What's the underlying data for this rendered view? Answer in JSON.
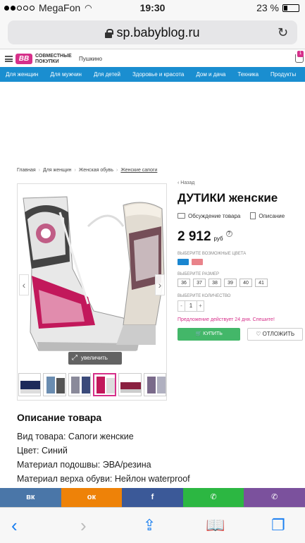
{
  "status_bar": {
    "carrier": "MegaFon",
    "time": "19:30",
    "battery": "23 %",
    "battery_level": 0.23
  },
  "browser": {
    "url": "sp.babyblog.ru"
  },
  "site": {
    "logo_text": "BB",
    "brand": "СОВМЕСТНЫЕ ПОКУПКИ",
    "city": "Пушкино",
    "cart_count": "1"
  },
  "nav": {
    "items": [
      "Для женщин",
      "Для мужчин",
      "Для детей",
      "Здоровье и красота",
      "Дом и дача",
      "Техника",
      "Продукты"
    ]
  },
  "breadcrumbs": [
    "Главная",
    "Для женщин",
    "Женская обувь",
    "Женские сапоги"
  ],
  "gallery": {
    "zoom_label": "увеличить",
    "thumb_count": 6,
    "active_thumb": 3
  },
  "product": {
    "back_label": "Назад",
    "title": "ДУТИКИ женские",
    "discuss_label": "Обсуждение товара",
    "description_label": "Описание",
    "price": "2 912",
    "currency": "руб",
    "colors_label": "ВЫБЕРИТЕ ВОЗМОЖНЫЕ ЦВЕТА",
    "colors": [
      "#1a86d0",
      "#e9838a"
    ],
    "size_label": "ВЫБЕРИТЕ РАЗМЕР",
    "sizes": [
      "36",
      "37",
      "38",
      "39",
      "40",
      "41"
    ],
    "qty_label": "ВЫБЕРИТЕ КОЛИЧЕСТВО",
    "qty_minus": "-",
    "qty_value": "1",
    "qty_plus": "+",
    "promo": "Предложение действует 24 дня. Спешите!",
    "buy_label": "КУПИТЬ",
    "later_label": "ОТЛОЖИТЬ"
  },
  "description": {
    "heading": "Описание товара",
    "rows": [
      "Вид товара: Сапоги женские",
      "Цвет: Синий",
      "Материал подошвы: ЭВА/резина",
      "Материал верха обуви: Нейлон waterproof"
    ]
  },
  "share": [
    {
      "label": "вк",
      "color": "#4a76a8"
    },
    {
      "label": "ок",
      "color": "#ee8208"
    },
    {
      "label": "f",
      "color": "#3b5998"
    },
    {
      "label": "✆",
      "color": "#2cb742"
    },
    {
      "label": "✆",
      "color": "#7b519d"
    }
  ],
  "colors": {
    "nav_blue": "#1a8ed0",
    "accent_pink": "#d6308a",
    "buy_green": "#43b769",
    "safari_blue": "#1a7ff0"
  }
}
